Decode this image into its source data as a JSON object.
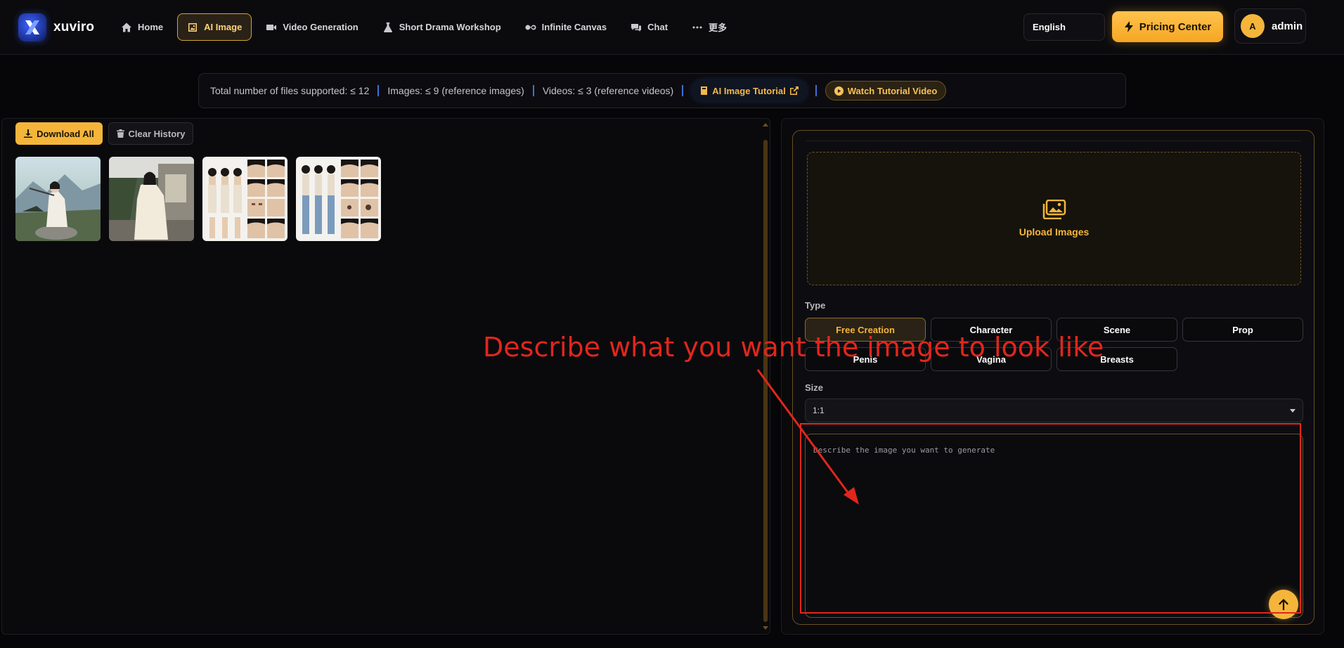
{
  "app": {
    "name": "xuviro"
  },
  "nav": {
    "items": [
      {
        "label": "Home",
        "icon": "home-icon",
        "active": false
      },
      {
        "label": "AI Image",
        "icon": "image-icon",
        "active": true
      },
      {
        "label": "Video Generation",
        "icon": "video-icon",
        "active": false
      },
      {
        "label": "Short Drama Workshop",
        "icon": "flask-icon",
        "active": false
      },
      {
        "label": "Infinite Canvas",
        "icon": "infinity-icon",
        "active": false
      },
      {
        "label": "Chat",
        "icon": "chat-icon",
        "active": false
      },
      {
        "label": "更多",
        "icon": "more-icon",
        "active": false
      }
    ]
  },
  "header": {
    "language": "English",
    "pricing_label": "Pricing Center",
    "user": {
      "initial": "A",
      "name": "admin"
    }
  },
  "info": {
    "total_files": "Total number of files supported: ≤ 12",
    "images": "Images: ≤ 9 (reference images)",
    "videos": "Videos: ≤ 3 (reference videos)",
    "tutorial_label": "AI Image Tutorial",
    "watch_label": "Watch Tutorial Video"
  },
  "history": {
    "download_all": "Download All",
    "clear_history": "Clear History",
    "thumbnails": [
      "generated-image-1",
      "generated-image-2",
      "generated-image-3",
      "generated-image-4"
    ]
  },
  "form": {
    "upload_label": "Upload Images",
    "type_label": "Type",
    "types": [
      {
        "label": "Free Creation",
        "selected": true
      },
      {
        "label": "Character",
        "selected": false
      },
      {
        "label": "Scene",
        "selected": false
      },
      {
        "label": "Prop",
        "selected": false
      },
      {
        "label": "Penis",
        "selected": false
      },
      {
        "label": "Vagina",
        "selected": false
      },
      {
        "label": "Breasts",
        "selected": false
      }
    ],
    "size_label": "Size",
    "size_value": "1:1",
    "prompt_placeholder": "Describe the image you want to generate"
  },
  "annotation": {
    "text": "Describe what you want the image to look like"
  },
  "colors": {
    "accent": "#f5b53b",
    "background": "#060608",
    "annotation_red": "#e1261c"
  }
}
